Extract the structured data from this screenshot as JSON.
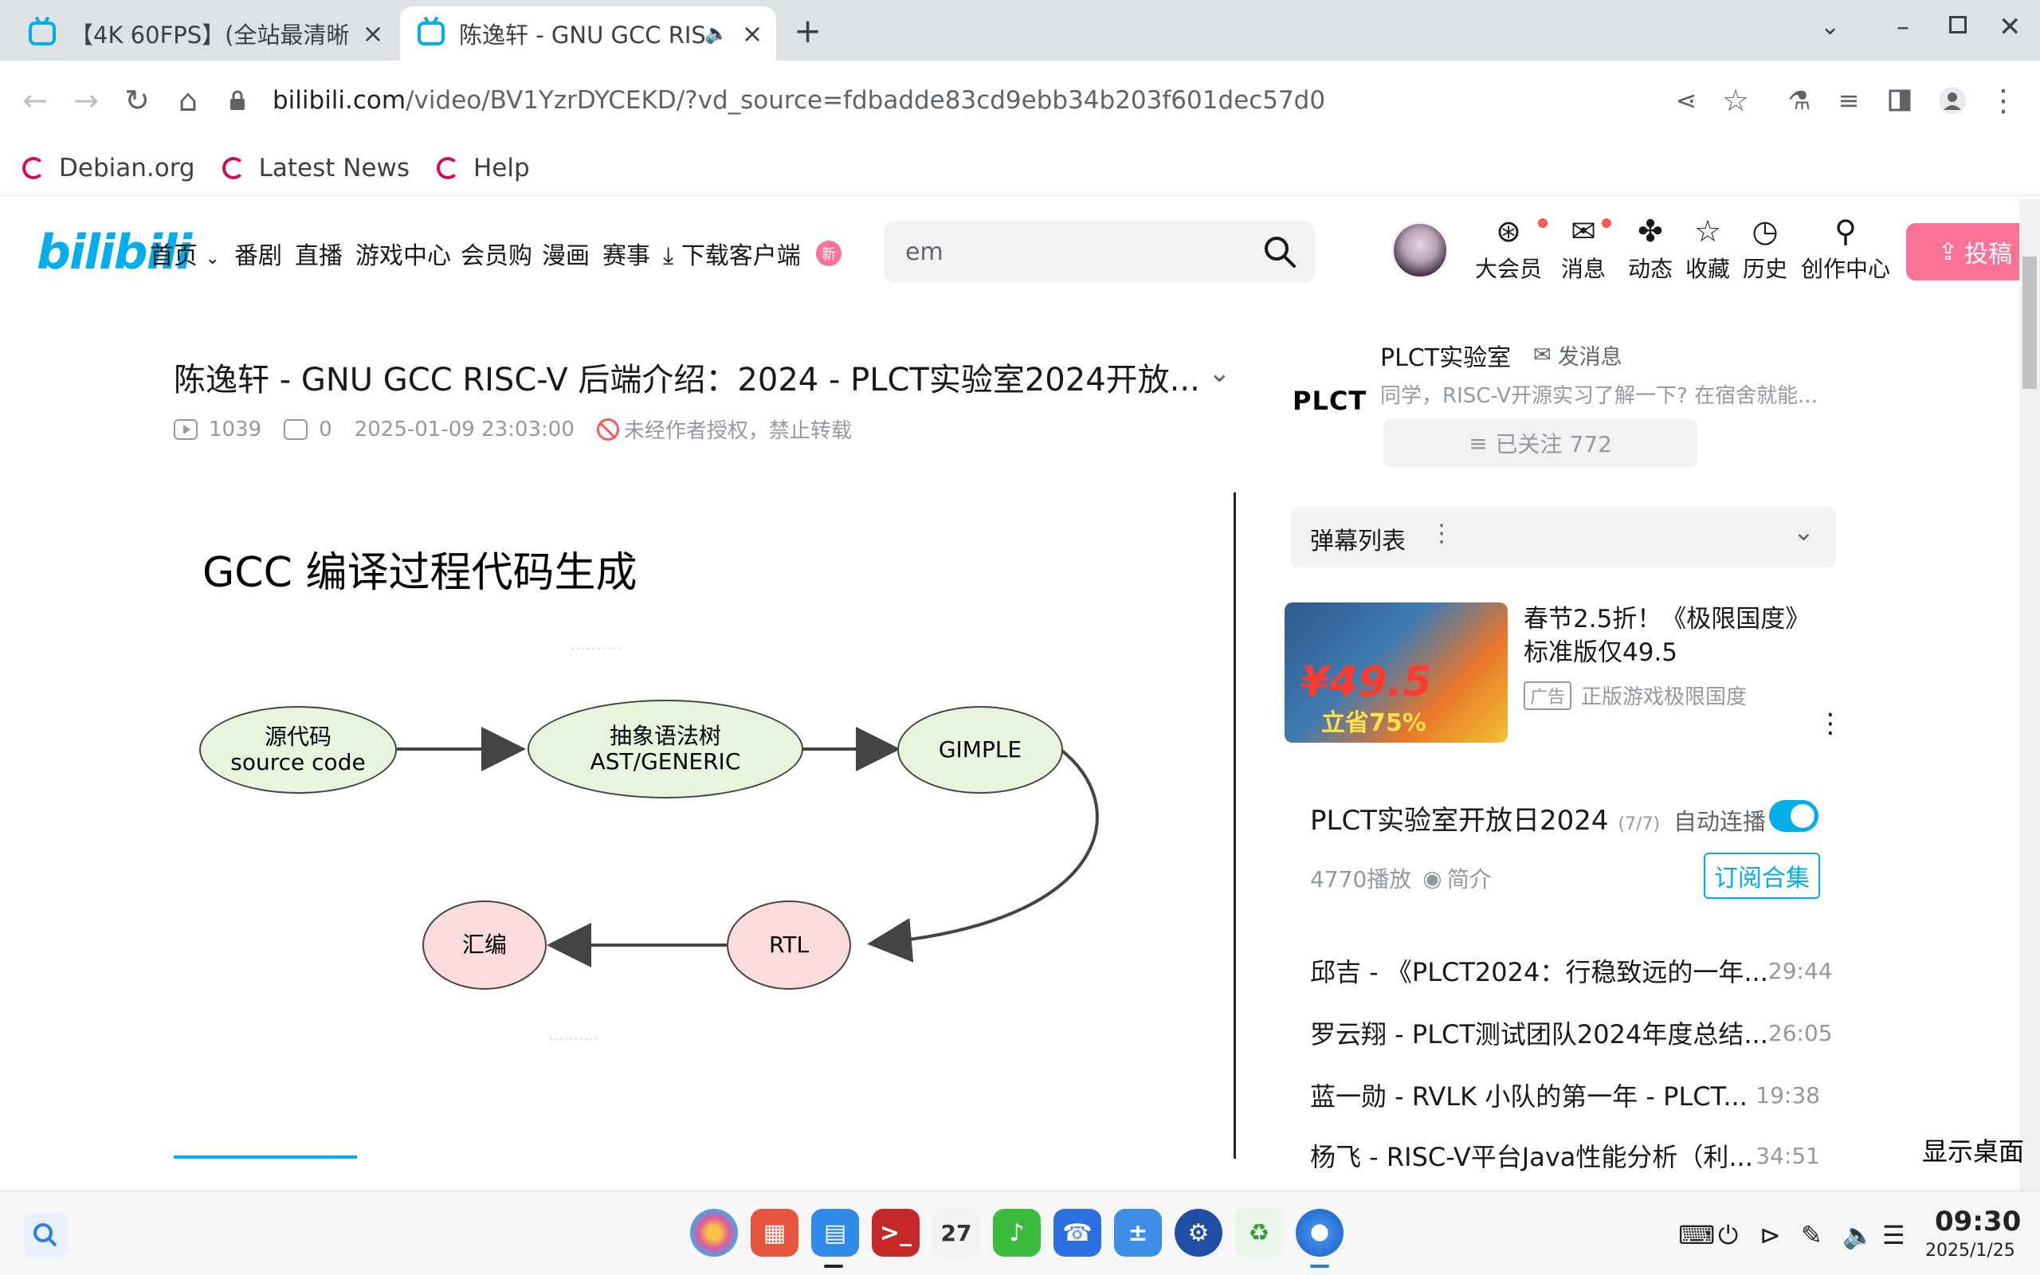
{
  "browser": {
    "tabs": [
      {
        "title": "【4K 60FPS】(全站最清晰",
        "icon": "bilibili-favicon-icon"
      },
      {
        "title": "陈逸轩 - GNU GCC RISC",
        "icon": "bilibili-favicon-icon"
      }
    ],
    "new_tab": "+",
    "url_host": "bilibili.com",
    "url_path": "/video/BV1YzrDYCEKD/?vd_source=fdbadde83cd9ebb34b203f601dec57d0",
    "bookmarks": [
      "Debian.org",
      "Latest News",
      "Help"
    ]
  },
  "site": {
    "logo": "bilibili",
    "nav": [
      "首页",
      "番剧",
      "直播",
      "游戏中心",
      "会员购",
      "漫画",
      "赛事",
      "下载客户端"
    ],
    "new_badge": "新",
    "search_value": "em",
    "actions": [
      "大会员",
      "消息",
      "动态",
      "收藏",
      "历史",
      "创作中心"
    ],
    "upload": "投稿"
  },
  "video": {
    "title": "陈逸轩 - GNU GCC RISC-V 后端介绍：2024 - PLCT实验室2024开放...",
    "plays": "1039",
    "danmaku": "0",
    "date": "2025-01-09 23:03:00",
    "copyright": "未经作者授权，禁止转载"
  },
  "slide": {
    "title": "GCC 编译过程代码生成",
    "nodes": {
      "source": {
        "zh": "源代码",
        "en": "source code"
      },
      "ast": {
        "zh": "抽象语法树",
        "en": "AST/GENERIC"
      },
      "gimple": "GIMPLE",
      "rtl": "RTL",
      "asm": "汇编"
    }
  },
  "uploader": {
    "logo_text": "PLCT",
    "name": "PLCT实验室",
    "message": "发消息",
    "desc": "同学，RISC-V开源实习了解一下? 在宿舍就能...",
    "follow": "已关注 772"
  },
  "danmu": {
    "title": "弹幕列表"
  },
  "ad": {
    "title": "春节2.5折！《极限国度》标准版仅49.5",
    "tag": "广告",
    "source": "正版游戏极限国度",
    "img_price": "¥49.5",
    "img_save": "立省75%"
  },
  "collection": {
    "title": "PLCT实验室开放日2024",
    "count": "(7/7)",
    "autoplay": "自动连播",
    "plays": "4770播放",
    "intro": "简介",
    "subscribe": "订阅合集",
    "episodes": [
      {
        "title": "邱吉 - 《PLCT2024：行稳致远的一年...",
        "duration": "29:44"
      },
      {
        "title": "罗云翔 - PLCT测试团队2024年度总结...",
        "duration": "26:05"
      },
      {
        "title": "蓝一勋 - RVLK 小队的第一年 - PLCT...",
        "duration": "19:38"
      },
      {
        "title": "杨飞 - RISC-V平台Java性能分析（利...",
        "duration": "34:51"
      }
    ]
  },
  "desktop": {
    "show_desktop": "显示桌面",
    "time": "09:30",
    "date": "2025/1/25",
    "calendar_day": "27"
  },
  "colors": {
    "bili_blue": "#00aeec",
    "bili_pink": "#fb7299"
  }
}
